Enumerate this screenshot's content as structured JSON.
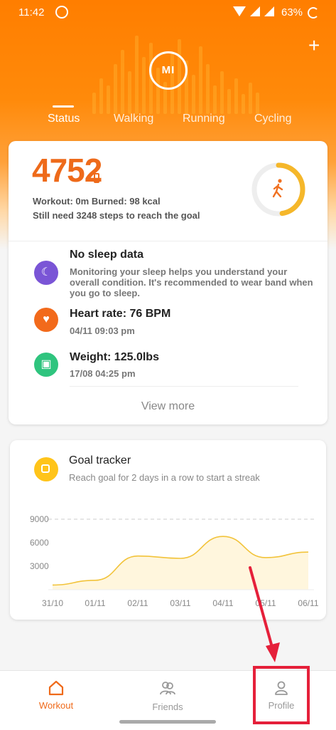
{
  "status_bar": {
    "time": "11:42",
    "battery": "63%"
  },
  "header": {
    "brand": "MI",
    "add_icon": "plus-icon",
    "tabs": [
      {
        "label": "Status",
        "active": true
      },
      {
        "label": "Walking",
        "active": false
      },
      {
        "label": "Running",
        "active": false
      },
      {
        "label": "Cycling",
        "active": false
      }
    ]
  },
  "steps_card": {
    "steps": "4752",
    "line1": "Workout: 0m Burned: 98 kcal",
    "line2": "Still need 3248 steps to reach the goal",
    "progress": 0.4752,
    "items": [
      {
        "icon": "moon-icon",
        "color": "#7a55d6",
        "title": "No sleep data",
        "desc": "Monitoring your sleep helps you understand your overall condition. It's recommended to wear band when you go to sleep."
      },
      {
        "icon": "heart-icon",
        "color": "#f26a1b",
        "title": "Heart rate: 76 BPM",
        "desc": "04/11 09:03 pm"
      },
      {
        "icon": "scale-icon",
        "color": "#2fc47e",
        "title": "Weight: 125.0lbs",
        "desc": "17/08 04:25 pm"
      }
    ],
    "view_more": "View more"
  },
  "goal_card": {
    "title": "Goal tracker",
    "subtitle": "Reach goal for 2 days in a row to start a streak"
  },
  "chart_data": {
    "type": "line",
    "categories": [
      "31/10",
      "01/11",
      "02/11",
      "03/11",
      "04/11",
      "05/11",
      "06/11"
    ],
    "values": [
      600,
      1200,
      4300,
      4000,
      6800,
      4100,
      4800
    ],
    "yticks": [
      "9000",
      "6000",
      "3000"
    ],
    "ylim": [
      0,
      10000
    ],
    "goal_line": 9000,
    "colors": {
      "line": "#f2c33a",
      "fill": "#fff6dd"
    }
  },
  "bottom_nav": [
    {
      "label": "Workout",
      "icon": "home-icon",
      "active": true
    },
    {
      "label": "Friends",
      "icon": "friends-icon",
      "active": false
    },
    {
      "label": "Profile",
      "icon": "person-icon",
      "active": false
    }
  ],
  "colors": {
    "accent": "#ff7e00",
    "steps": "#ee6a1a",
    "highlight": "#e5203a"
  }
}
